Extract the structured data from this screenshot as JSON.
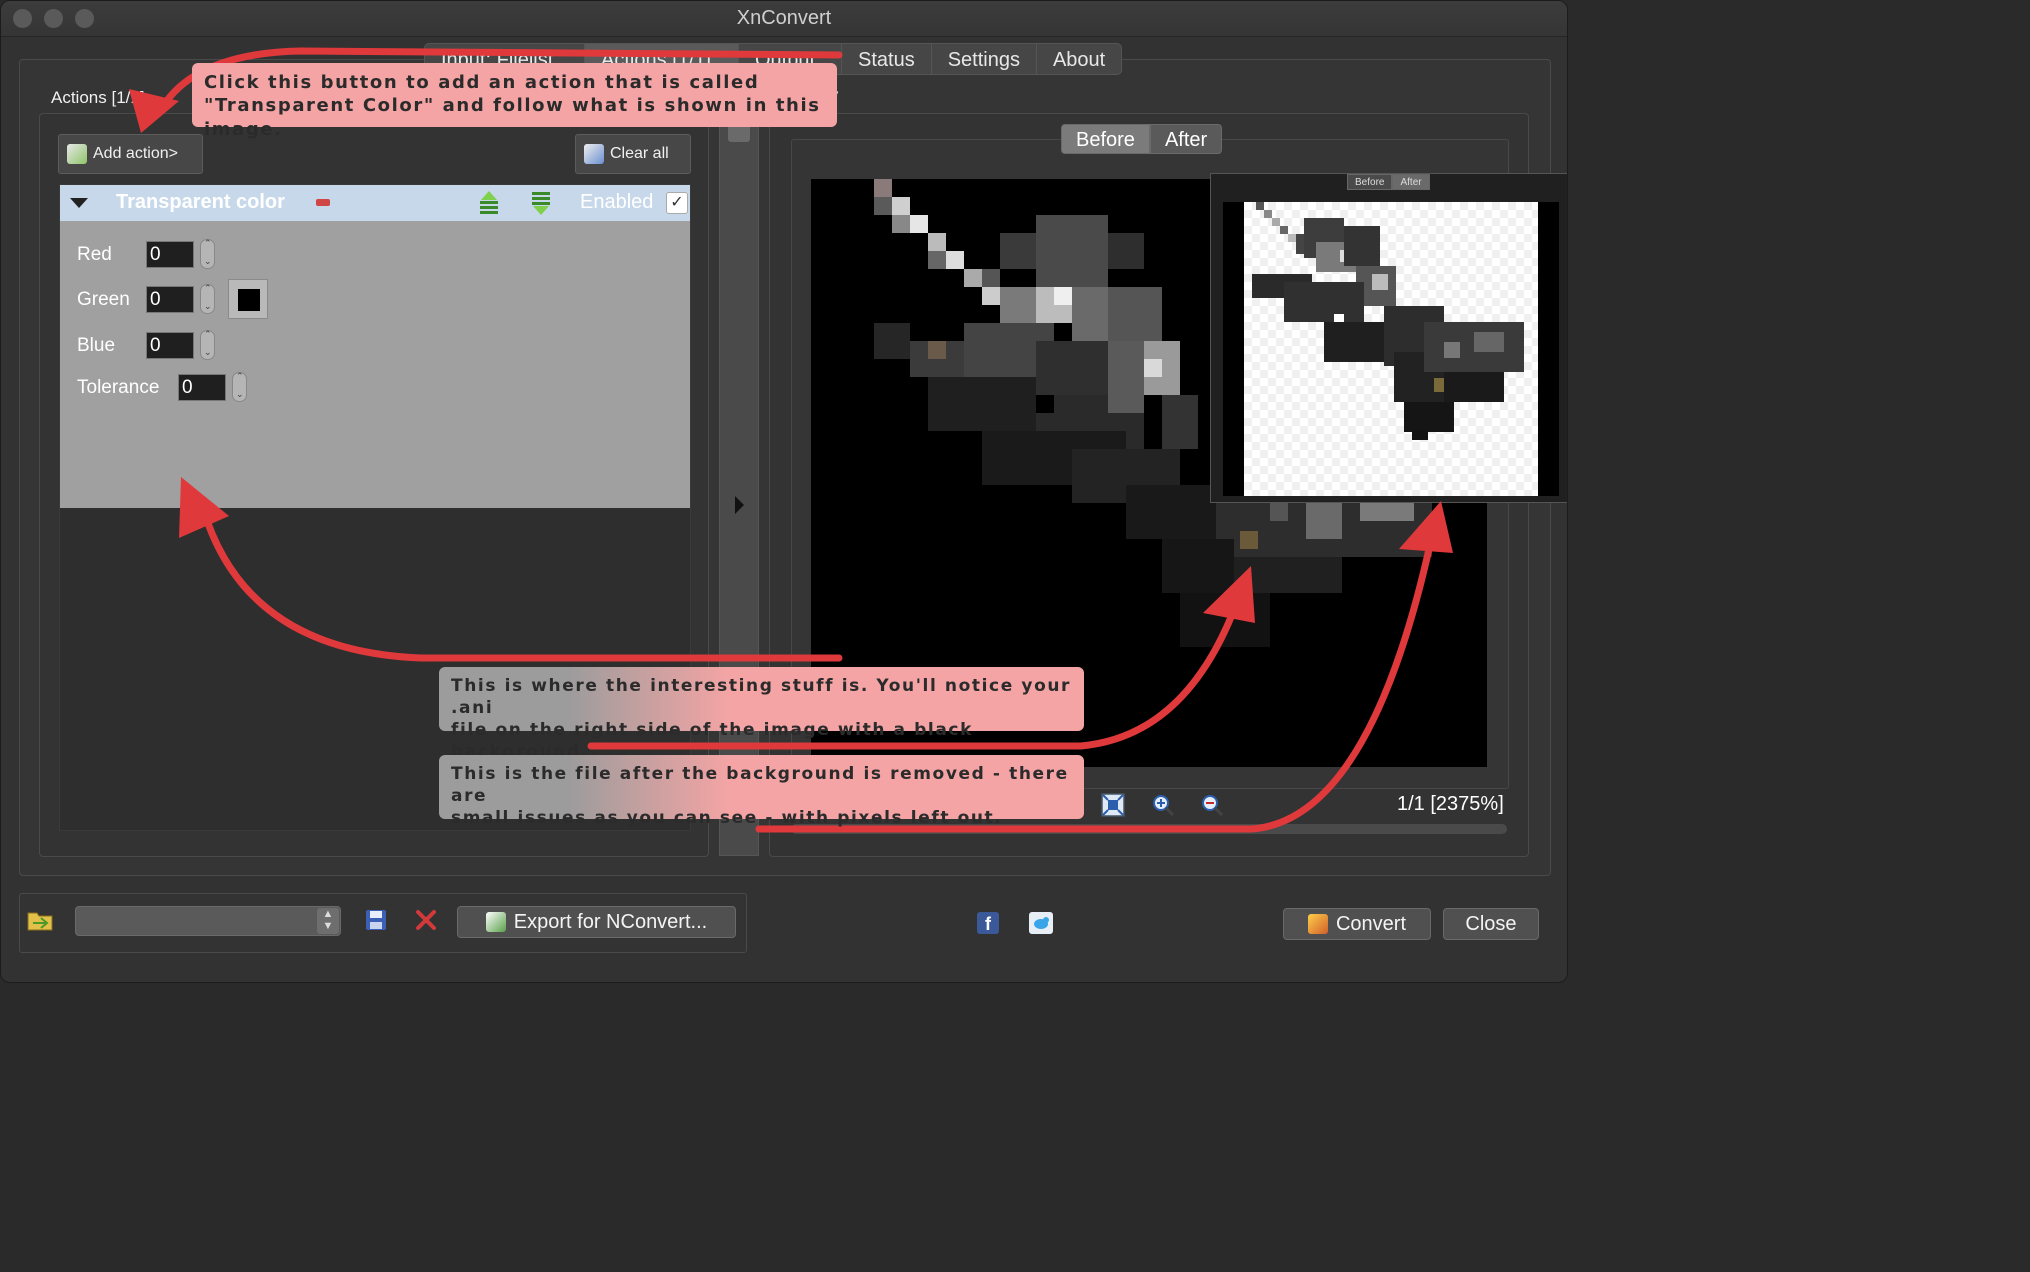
{
  "window": {
    "title": "XnConvert"
  },
  "tabs": [
    {
      "label": "Input: Filelist"
    },
    {
      "label": "Actions [1/1]"
    },
    {
      "label": "Output"
    },
    {
      "label": "Status"
    },
    {
      "label": "Settings"
    },
    {
      "label": "About"
    }
  ],
  "actions_panel": {
    "label": "Actions [1/1]",
    "add_action_label": "Add action>",
    "clear_all_label": "Clear all",
    "action": {
      "name": "Transparent color",
      "enabled_label": "Enabled",
      "enabled": true,
      "fields": {
        "red_label": "Red",
        "red_value": "0",
        "green_label": "Green",
        "green_value": "0",
        "blue_label": "Blue",
        "blue_value": "0",
        "tolerance_label": "Tolerance",
        "tolerance_value": "0"
      },
      "color_swatch": "#000000"
    }
  },
  "preview": {
    "segment_before": "Before",
    "segment_after": "After",
    "inset_before": "Before",
    "inset_after": "After",
    "zoom_status": "1/1 [2375%]"
  },
  "bottom_bar": {
    "export_label": "Export for NConvert...",
    "convert_label": "Convert",
    "close_label": "Close"
  },
  "annotations": {
    "note1_line1": "Click this button to add an action that is called",
    "note1_line2": "\"Transparent Color\" and follow what is shown in this image.",
    "note2_line1": "This is where the interesting stuff is. You'll notice your .ani",
    "note2_line2": "file on the right side of the image with a black background.",
    "note3_line1": "This is the file after the background is removed - there are",
    "note3_line2": "small issues as you can see - with pixels left out."
  },
  "colors": {
    "annotation": "#f4a4a4",
    "arrow": "#e0393c",
    "header_highlight": "#c7d8ea"
  }
}
